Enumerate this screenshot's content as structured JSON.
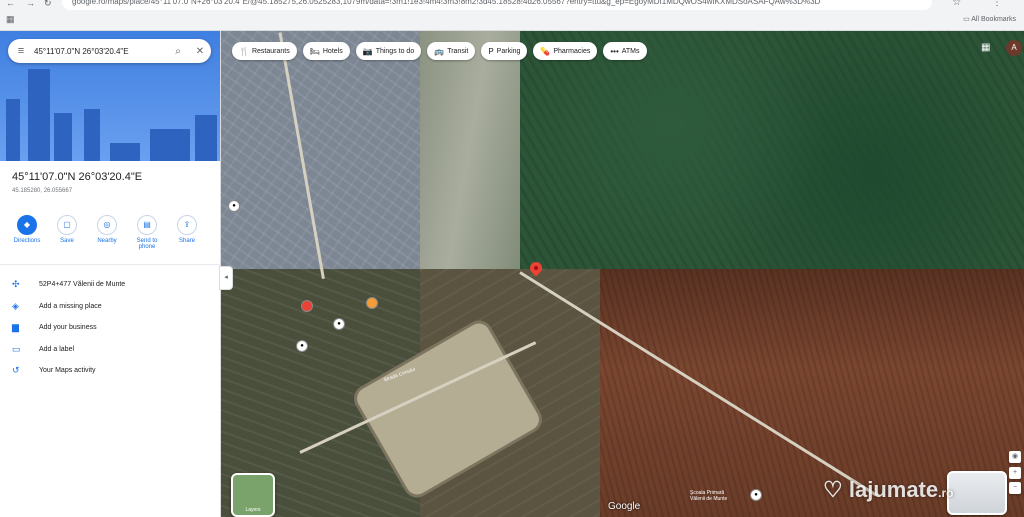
{
  "browser": {
    "url": "google.ro/maps/place/45°11'07.0\"N+26°03'20.4\"E/@45.185275,26.0525283,1079m/data=!3m1!1e3!4m4!3m3!8m2!3d45.18528!4d26.05567?entry=ttu&g_ep=EgoyMDI1MDQwOS4wIKXMDSoASAFQAw%3D%3D",
    "bookmarks_label": "All Bookmarks"
  },
  "search": {
    "value": "45°11'07.0\"N 26°03'20.4\"E"
  },
  "chips": [
    {
      "icon": "🍴",
      "label": "Restaurants"
    },
    {
      "icon": "🛏",
      "label": "Hotels"
    },
    {
      "icon": "📷",
      "label": "Things to do"
    },
    {
      "icon": "🚌",
      "label": "Transit"
    },
    {
      "icon": "P",
      "label": "Parking"
    },
    {
      "icon": "💊",
      "label": "Pharmacies"
    },
    {
      "icon": "•••",
      "label": "ATMs"
    }
  ],
  "place": {
    "title": "45°11'07.0\"N 26°03'20.4\"E",
    "subtitle": "45.185280, 26.055667"
  },
  "actions": [
    {
      "icon": "◆",
      "label": "Directions"
    },
    {
      "icon": "▢",
      "label": "Save"
    },
    {
      "icon": "◎",
      "label": "Nearby"
    },
    {
      "icon": "▤",
      "label": "Send to\nphone"
    },
    {
      "icon": "⇪",
      "label": "Share"
    }
  ],
  "list": [
    {
      "icon": "✣",
      "label": "52P4+477 Vălenii de Munte"
    },
    {
      "icon": "◈",
      "label": "Add a missing place"
    },
    {
      "icon": "▆",
      "label": "Add your business"
    },
    {
      "icon": "▭",
      "label": "Add a label"
    },
    {
      "icon": "↺",
      "label": "Your Maps activity"
    }
  ],
  "map": {
    "layers_label": "Layers",
    "google_label": "Google",
    "street_label": "Strada Crinului",
    "place_label": "Școala Primară\nVălenii de Munte",
    "avatar_letter": "A"
  },
  "watermark": {
    "text": "lajumate",
    "suffix": ".ro"
  }
}
